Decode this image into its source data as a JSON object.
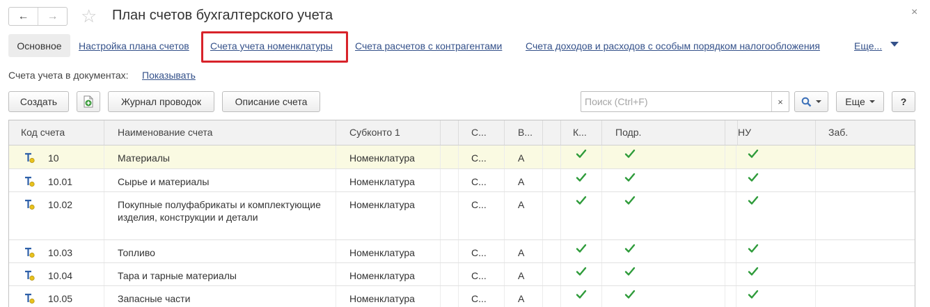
{
  "header": {
    "title": "План счетов бухгалтерского учета",
    "back_symbol": "←",
    "forward_symbol": "→",
    "star_symbol": "☆",
    "close_symbol": "×"
  },
  "tabs": [
    {
      "label": "Основное"
    },
    {
      "label": "Настройка плана счетов"
    },
    {
      "label": "Счета учета номенклатуры"
    },
    {
      "label": "Счета расчетов с контрагентами"
    },
    {
      "label": "Счета доходов и расходов с особым порядком налогообложения"
    },
    {
      "label": "Еще..."
    }
  ],
  "docs": {
    "label": "Счета учета в документах:",
    "link": "Показывать"
  },
  "toolbar": {
    "create": "Создать",
    "journal": "Журнал проводок",
    "description": "Описание счета",
    "search_placeholder": "Поиск (Ctrl+F)",
    "search_clear": "×",
    "more": "Еще",
    "help": "?"
  },
  "table": {
    "columns": [
      "Код счета",
      "Наименование счета",
      "Субконто 1",
      "",
      "С...",
      "В...",
      "",
      "К...",
      "Подр.",
      "",
      "НУ",
      "Заб."
    ],
    "rows": [
      {
        "code": "10",
        "name": "Материалы",
        "sub1": "Номенклатура",
        "s": "С...",
        "v": "А",
        "k": true,
        "podr": true,
        "nu": true,
        "selected": true
      },
      {
        "code": "10.01",
        "name": "Сырье и материалы",
        "sub1": "Номенклатура",
        "s": "С...",
        "v": "А",
        "k": true,
        "podr": true,
        "nu": true
      },
      {
        "code": "10.02",
        "name": "Покупные полуфабрикаты и комплектующие изделия, конструкции и детали",
        "sub1": "Номенклатура",
        "s": "С...",
        "v": "А",
        "k": true,
        "podr": true,
        "nu": true
      },
      {
        "code": "10.03",
        "name": "Топливо",
        "sub1": "Номенклатура",
        "s": "С...",
        "v": "А",
        "k": true,
        "podr": true,
        "nu": true
      },
      {
        "code": "10.04",
        "name": "Тара и тарные материалы",
        "sub1": "Номенклатура",
        "s": "С...",
        "v": "А",
        "k": true,
        "podr": true,
        "nu": true
      },
      {
        "code": "10.05",
        "name": "Запасные части",
        "sub1": "Номенклатура",
        "s": "С...",
        "v": "А",
        "k": true,
        "podr": true,
        "nu": true
      }
    ]
  },
  "colors": {
    "link": "#34518a",
    "highlight": "#d8232a",
    "check": "#2e9b3a",
    "selected_row": "#fafae2"
  }
}
